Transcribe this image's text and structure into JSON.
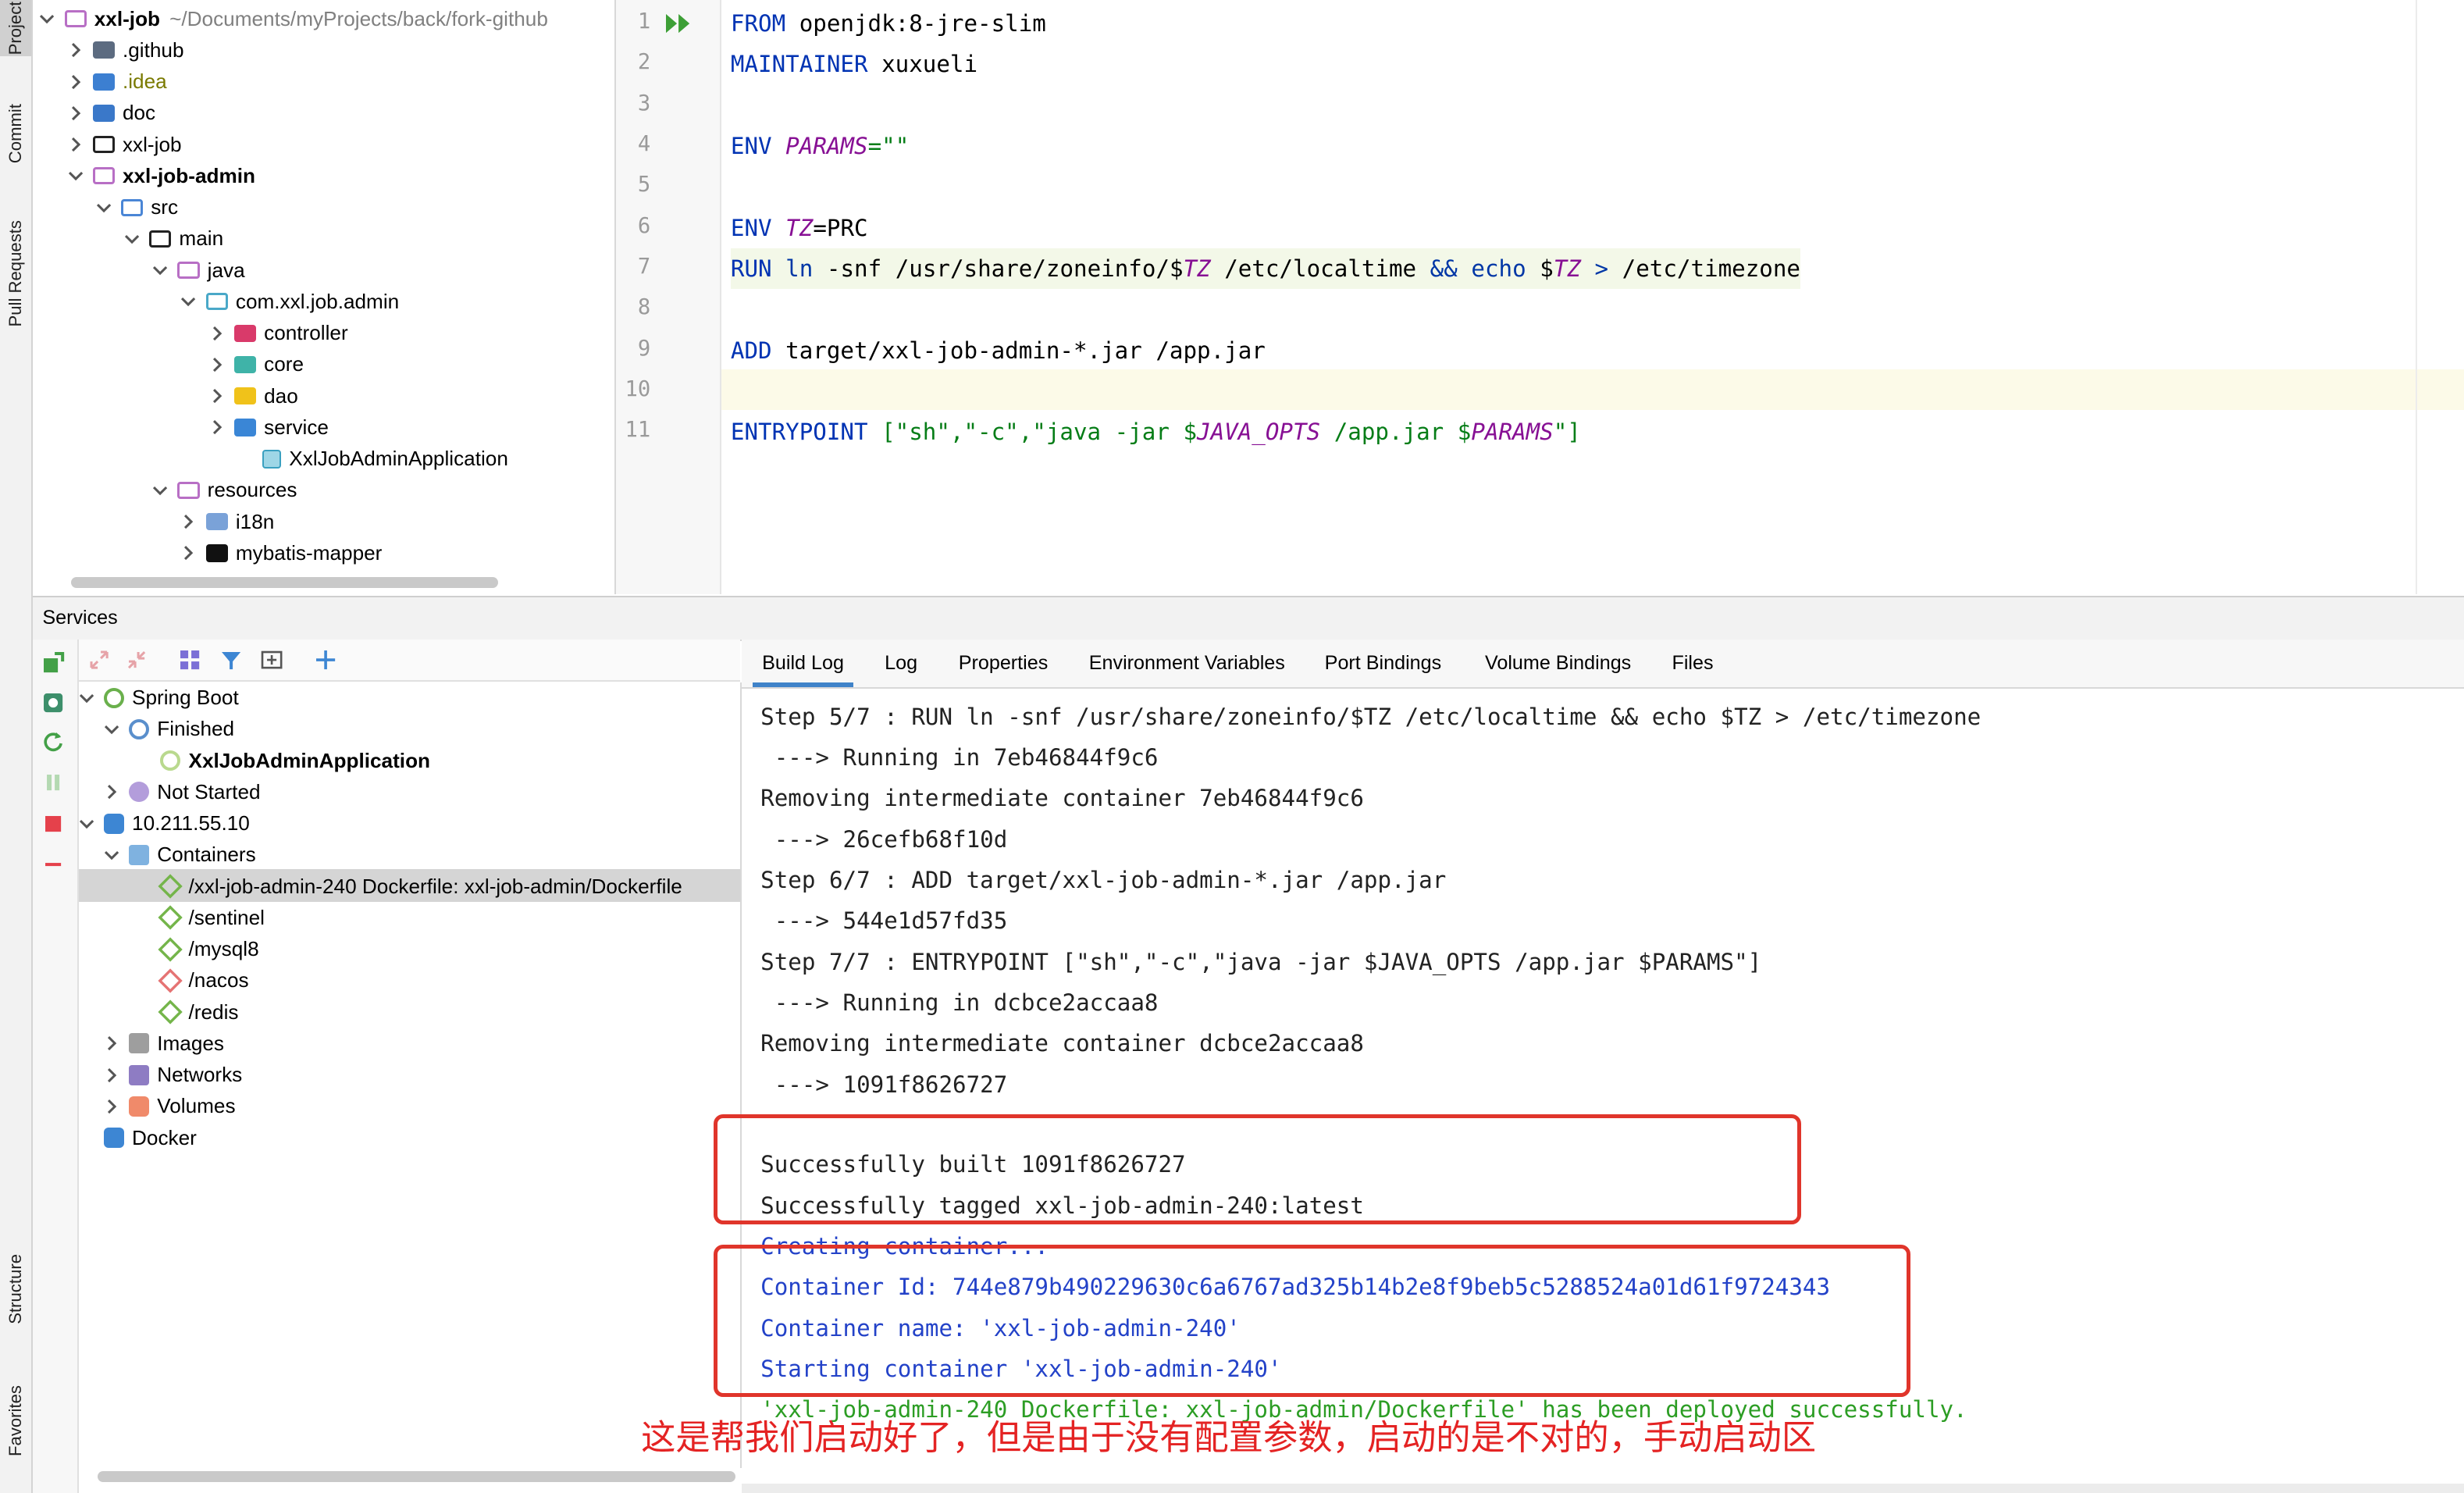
{
  "toolstrip": {
    "project_label": "Project",
    "commit_label": "Commit",
    "pull_requests_label": "Pull Requests",
    "structure_label": "Structure",
    "favorites_label": "Favorites"
  },
  "project_tree": {
    "root_name": "xxl-job",
    "root_path": "~/Documents/myProjects/back/fork-github",
    "items": [
      {
        "label": ".github",
        "icon": "folder-settings-icon"
      },
      {
        "label": ".idea",
        "icon": "folder-idea-icon"
      },
      {
        "label": "doc",
        "icon": "folder-blue-icon"
      },
      {
        "label": "xxl-job",
        "icon": "folder-icon"
      },
      {
        "label": "xxl-job-admin",
        "icon": "module-folder-icon"
      },
      {
        "label": "src",
        "icon": "source-folder-icon"
      },
      {
        "label": "main",
        "icon": "folder-icon"
      },
      {
        "label": "java",
        "icon": "java-folder-icon"
      },
      {
        "label": "com.xxl.job.admin",
        "icon": "package-icon"
      },
      {
        "label": "controller",
        "icon": "package-controller-icon"
      },
      {
        "label": "core",
        "icon": "package-core-icon"
      },
      {
        "label": "dao",
        "icon": "package-dao-icon"
      },
      {
        "label": "service",
        "icon": "package-service-icon"
      },
      {
        "label": "XxlJobAdminApplication",
        "icon": "spring-class-icon"
      },
      {
        "label": "resources",
        "icon": "resources-folder-icon"
      },
      {
        "label": "i18n",
        "icon": "folder-i18n-icon"
      },
      {
        "label": "mybatis-mapper",
        "icon": "folder-dark-icon"
      }
    ]
  },
  "editor": {
    "line_numbers": [
      "1",
      "2",
      "3",
      "4",
      "5",
      "6",
      "7",
      "8",
      "9",
      "10",
      "11"
    ],
    "code": {
      "l1_kw": "FROM",
      "l1_rest": " openjdk:8-jre-slim",
      "l2_kw": "MAINTAINER",
      "l2_rest": " xuxueli",
      "l4_kw": "ENV",
      "l4_var": "PARAMS",
      "l4_rest": "=\"\"",
      "l6_kw": "ENV",
      "l6_var": "TZ",
      "l6_rest": "=PRC",
      "l7_kw": "RUN",
      "l7_ln": "ln",
      "l7_a": " -snf /usr/share/zoneinfo/$",
      "l7_tz1": "TZ",
      "l7_b": " /etc/localtime ",
      "l7_and": "&&",
      "l7_sp": " ",
      "l7_echo": "echo",
      "l7_c": " $",
      "l7_tz2": "TZ",
      "l7_gt": " >",
      "l7_d": " /etc/timezone",
      "l9_kw": "ADD",
      "l9_rest": " target/xxl-job-admin-*.jar /app.jar",
      "l11_kw": "ENTRYPOINT",
      "l11_a": " [\"sh\",\"-c\",\"java -jar $",
      "l11_v1": "JAVA_OPTS",
      "l11_b": " /app.jar $",
      "l11_v2": "PARAMS",
      "l11_c": "\"]"
    }
  },
  "services": {
    "title": "Services",
    "tree": {
      "spring_boot": "Spring Boot",
      "finished": "Finished",
      "app": "XxlJobAdminApplication",
      "not_started": "Not Started",
      "host": "10.211.55.10",
      "containers": "Containers",
      "container_items": [
        "/xxl-job-admin-240 Dockerfile: xxl-job-admin/Dockerfile",
        "/sentinel",
        "/mysql8",
        "/nacos",
        "/redis"
      ],
      "images": "Images",
      "networks": "Networks",
      "volumes": "Volumes",
      "docker": "Docker"
    }
  },
  "log_tabs": [
    "Build Log",
    "Log",
    "Properties",
    "Environment Variables",
    "Port Bindings",
    "Volume Bindings",
    "Files"
  ],
  "console": {
    "lines": [
      "Step 5/7 : RUN ln -snf /usr/share/zoneinfo/$TZ /etc/localtime && echo $TZ > /etc/timezone",
      " ---> Running in 7eb46844f9c6",
      "Removing intermediate container 7eb46844f9c6",
      " ---> 26cefb68f10d",
      "Step 6/7 : ADD target/xxl-job-admin-*.jar /app.jar",
      " ---> 544e1d57fd35",
      "Step 7/7 : ENTRYPOINT [\"sh\",\"-c\",\"java -jar $JAVA_OPTS /app.jar $PARAMS\"]",
      " ---> Running in dcbce2accaa8",
      "Removing intermediate container dcbce2accaa8",
      " ---> 1091f8626727",
      "",
      "Successfully built 1091f8626727",
      "Successfully tagged xxl-job-admin-240:latest",
      "Creating container...",
      "Container Id: 744e879b490229630c6a6767ad325b14b2e8f9beb5c5288524a01d61f9724343",
      "Container name: 'xxl-job-admin-240'",
      "Starting container 'xxl-job-admin-240'",
      "'xxl-job-admin-240 Dockerfile: xxl-job-admin/Dockerfile' has been deployed successfully."
    ]
  },
  "annotation": "这是帮我们启动好了，但是由于没有配置参数，启动的是不对的，手动启动区",
  "colors": {
    "keyword": "#0033b3",
    "variable": "#871094",
    "string": "#067d17",
    "console_blue": "#2342c8",
    "console_green": "#2c9d24",
    "annotation_red": "#e42323",
    "tab_underline": "#4083c9"
  }
}
